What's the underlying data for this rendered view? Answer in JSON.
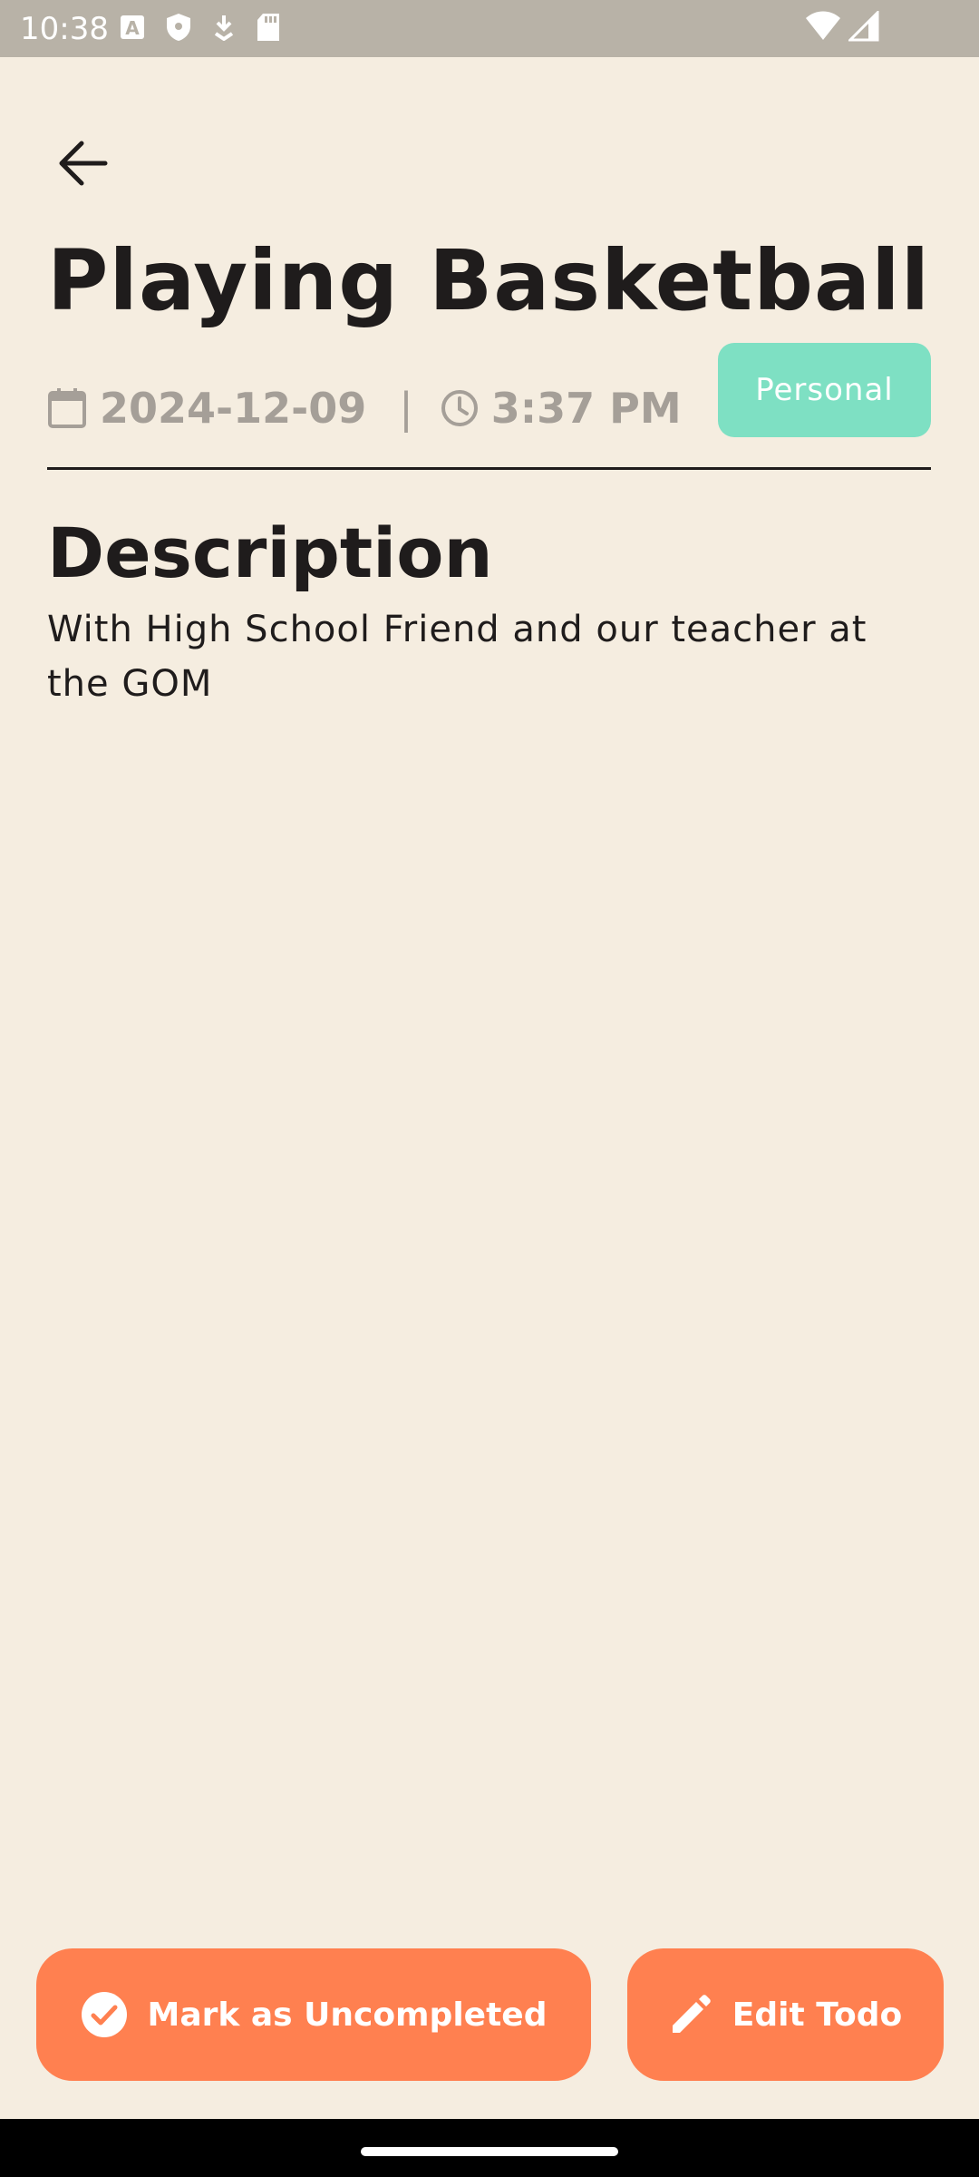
{
  "status_bar": {
    "time": "10:38",
    "left_icons": [
      "font-icon",
      "shield-icon",
      "download-icon",
      "sd-card-icon"
    ],
    "right_icons": [
      "wifi-icon",
      "signal-icon"
    ]
  },
  "todo": {
    "title": "Playing Basketball",
    "date": "2024-12-09",
    "separator": "|",
    "time": "3:37 PM",
    "category": "Personal",
    "description_heading": "Description",
    "description": "With High School Friend and our teacher at the GOM"
  },
  "actions": {
    "mark_uncompleted_label": "Mark as Uncompleted",
    "edit_label": "Edit Todo"
  },
  "colors": {
    "background": "#F5EDE0",
    "accent": "#FF8050",
    "category_badge": "#7EE0C3",
    "meta_text": "#A59F98",
    "status_bar": "#B8B2A7"
  }
}
